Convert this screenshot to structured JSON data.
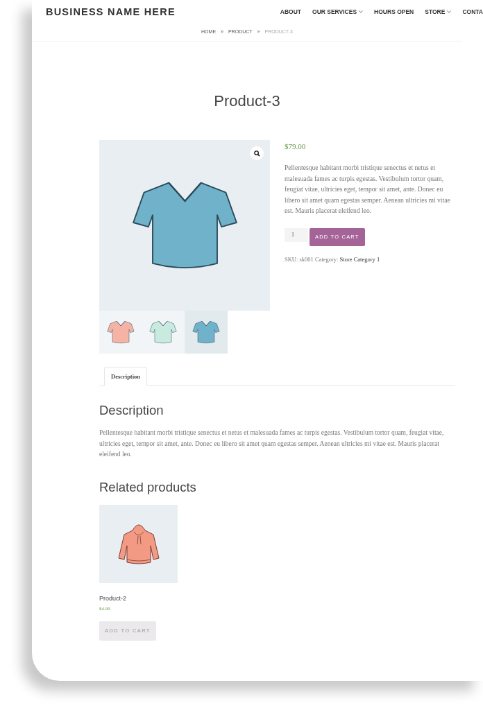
{
  "header": {
    "business_name": "BUSINESS NAME HERE",
    "nav": [
      {
        "label": "ABOUT",
        "dropdown": false
      },
      {
        "label": "OUR SERVICES",
        "dropdown": true
      },
      {
        "label": "HOURS OPEN",
        "dropdown": false
      },
      {
        "label": "STORE",
        "dropdown": true
      },
      {
        "label": "CONTA",
        "dropdown": false
      }
    ]
  },
  "breadcrumb": [
    {
      "kind": "link",
      "label": "HOME"
    },
    {
      "kind": "separator",
      "label": "»"
    },
    {
      "kind": "link",
      "label": "PRODUCT"
    },
    {
      "kind": "separator",
      "label": "»"
    },
    {
      "kind": "current",
      "label": "PRODUCT-3"
    }
  ],
  "product": {
    "title": "Product-3",
    "price": "$79.00",
    "description": "Pellentesque habitant morbi tristique senectus et netus et malesuada fames ac turpis egestas. Vestibulum tortor quam, feugiat vitae, ultricies eget, tempor sit amet, ante. Donec eu libero sit amet quam egestas semper. Aenean ultricies mi vitae est. Mauris placerat eleifend leo.",
    "quantity": "1",
    "add_to_cart": "ADD TO CART",
    "sku_label": "SKU:",
    "sku": "sk001",
    "category_label": "Category:",
    "category": "Store Category 1",
    "thumbnails": [
      {
        "color": "#f4b3a5",
        "selected": false
      },
      {
        "color": "#c9eade",
        "selected": false
      },
      {
        "color": "#6fb2c9",
        "selected": true
      }
    ]
  },
  "tabs": [
    {
      "label": "Description",
      "selected": true
    }
  ],
  "description": {
    "heading": "Description",
    "text": "Pellentesque habitant morbi tristique senectus et netus et malesuada fames ac turpis egestas. Vestibulum tortor quam, feugiat vitae, ultricies eget, tempor sit amet, ante. Donec eu libero sit amet quam egestas semper. Aenean ultricies mi vitae est. Mauris placerat eleifend leo."
  },
  "related": {
    "heading": "Related products",
    "items": [
      {
        "name": "Product-2",
        "price": "$4.99",
        "button": "ADD TO CART"
      }
    ]
  }
}
